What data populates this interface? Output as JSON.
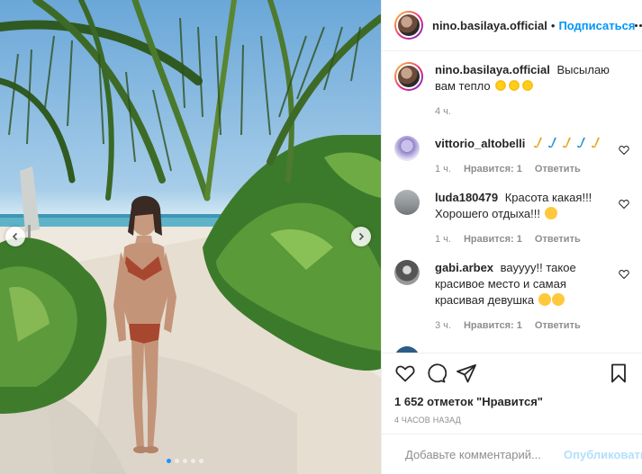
{
  "header": {
    "username": "nino.basilaya.official",
    "separator": "•",
    "follow_label": "Подписаться"
  },
  "caption": {
    "username": "nino.basilaya.official",
    "text": "Высылаю вам тепло",
    "emoji": "sun-emoji x3",
    "time": "4 ч."
  },
  "comments": [
    {
      "username": "vittorio_altobelli",
      "text": "",
      "emoji": "saxophone-emoji x5",
      "time": "1 ч.",
      "likes": "Нравится: 1",
      "reply": "Ответить"
    },
    {
      "username": "luda180479",
      "text": "Красота какая!!! Хорошего отдыха!!!",
      "emoji": "smiling-face-emoji",
      "time": "1 ч.",
      "likes": "Нравится: 1",
      "reply": "Ответить"
    },
    {
      "username": "gabi.arbex",
      "text": "вауууу!! такое красивое место и самая красивая девушка",
      "emoji": "heart-eyes-emoji x2",
      "time": "3 ч.",
      "likes": "Нравится: 1",
      "reply": "Ответить"
    }
  ],
  "actions": {
    "likes_count": "1 652 отметок \"Нравится\"",
    "posted_time": "4 ЧАСОВ НАЗАД"
  },
  "add_comment": {
    "placeholder": "Добавьте комментарий...",
    "publish_label": "Опубликовать"
  },
  "carousel": {
    "slide_count": 5,
    "active_index": 0
  },
  "colors": {
    "accent": "#0095f6",
    "publish_disabled": "#b2dffc",
    "muted_text": "#8e8e8e"
  }
}
